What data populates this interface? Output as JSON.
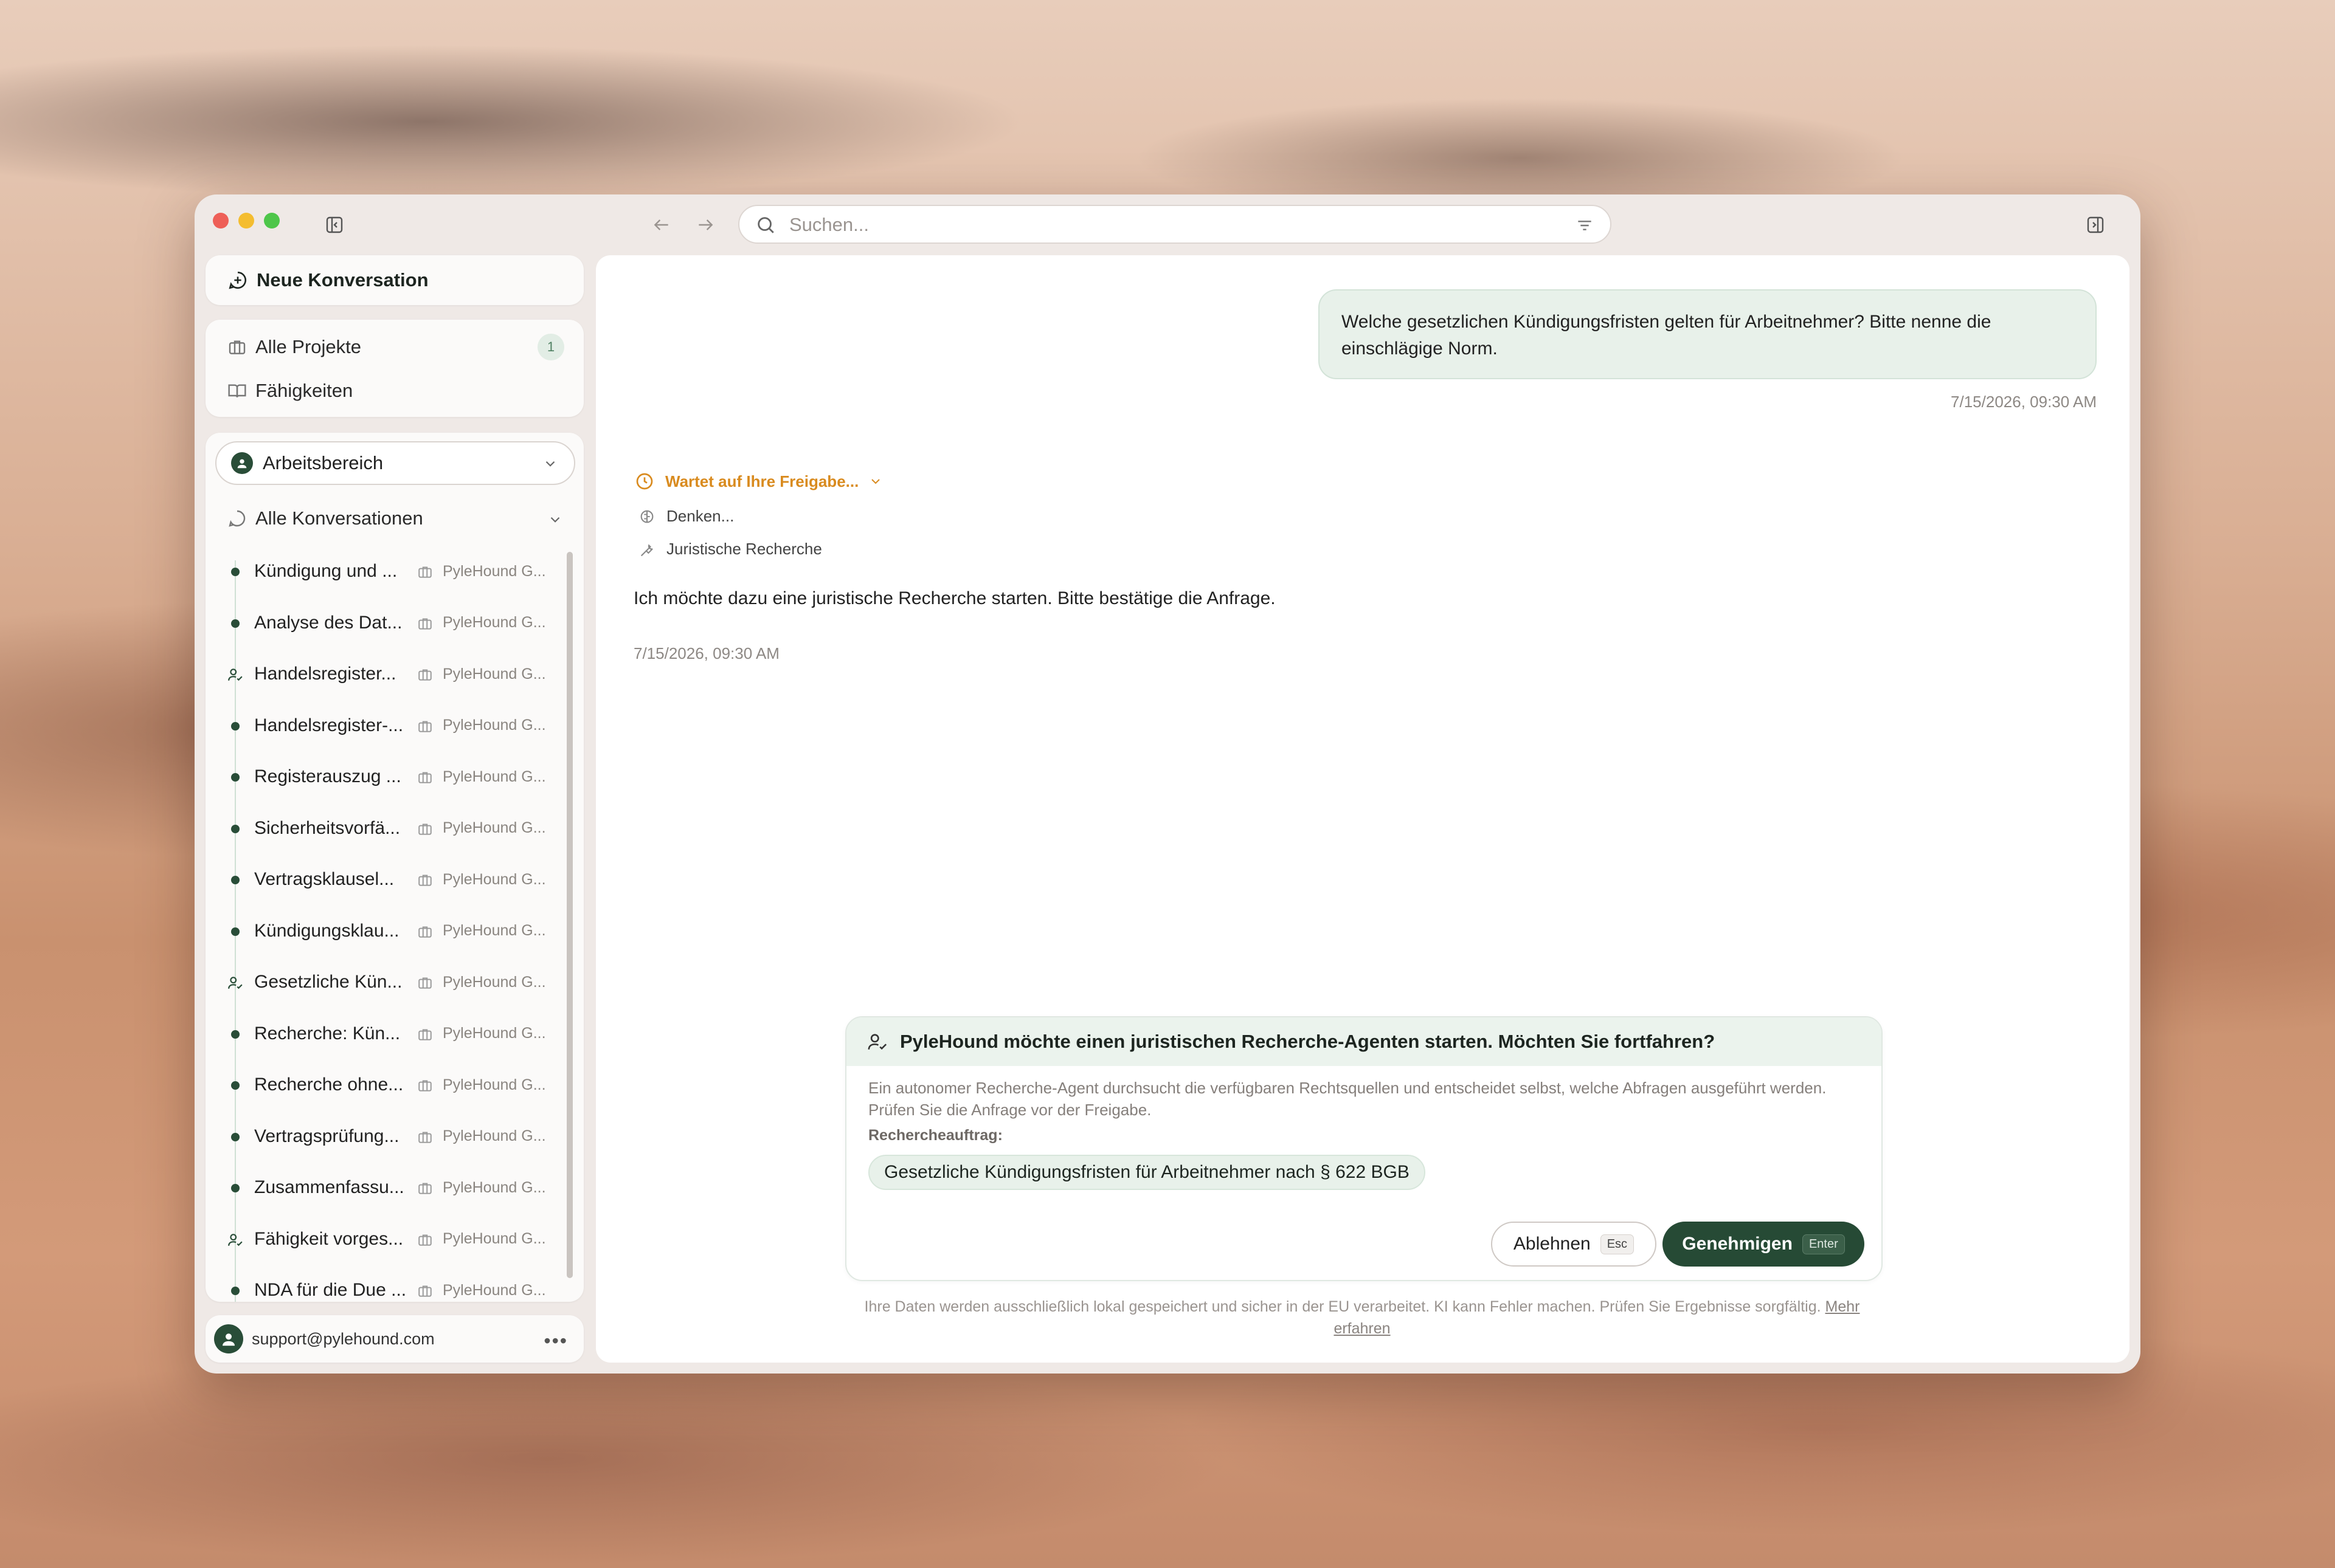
{
  "search": {
    "placeholder": "Suchen..."
  },
  "sidebar": {
    "new_conversation": "Neue Konversation",
    "nav": [
      {
        "label": "Alle Projekte",
        "badge": "1"
      },
      {
        "label": "Fähigkeiten"
      }
    ],
    "workspace": "Arbeitsbereich",
    "all_conversations": "Alle Konversationen",
    "conversations": [
      {
        "title": "Kündigung und ...",
        "project": "PyleHound G...",
        "marker": "dot"
      },
      {
        "title": "Analyse des Dat...",
        "project": "PyleHound G...",
        "marker": "dot"
      },
      {
        "title": "Handelsregister...",
        "project": "PyleHound G...",
        "marker": "user-check"
      },
      {
        "title": "Handelsregister-...",
        "project": "PyleHound G...",
        "marker": "dot"
      },
      {
        "title": "Registerauszug ...",
        "project": "PyleHound G...",
        "marker": "dot"
      },
      {
        "title": "Sicherheitsvorfä...",
        "project": "PyleHound G...",
        "marker": "dot"
      },
      {
        "title": "Vertragsklausel...",
        "project": "PyleHound G...",
        "marker": "dot"
      },
      {
        "title": "Kündigungsklau...",
        "project": "PyleHound G...",
        "marker": "dot"
      },
      {
        "title": "Gesetzliche Kün...",
        "project": "PyleHound G...",
        "marker": "user-check"
      },
      {
        "title": "Recherche: Kün...",
        "project": "PyleHound G...",
        "marker": "dot"
      },
      {
        "title": "Recherche ohne...",
        "project": "PyleHound G...",
        "marker": "dot"
      },
      {
        "title": "Vertragsprüfung...",
        "project": "PyleHound G...",
        "marker": "dot"
      },
      {
        "title": "Zusammenfassu...",
        "project": "PyleHound G...",
        "marker": "dot"
      },
      {
        "title": "Fähigkeit vorges...",
        "project": "PyleHound G...",
        "marker": "user-check"
      },
      {
        "title": "NDA für die Due ...",
        "project": "PyleHound G...",
        "marker": "dot"
      }
    ],
    "user_email": "support@pylehound.com"
  },
  "chat": {
    "user_message": "Welche gesetzlichen Kündigungsfristen gelten für Arbeitnehmer? Bitte nenne die einschlägige Norm.",
    "user_timestamp": "7/15/2026, 09:30 AM",
    "status": "Wartet auf Ihre Freigabe...",
    "steps": [
      "Denken...",
      "Juristische Recherche"
    ],
    "assistant_message": "Ich möchte dazu eine juristische Recherche starten. Bitte bestätige die Anfrage.",
    "assistant_timestamp": "7/15/2026, 09:30 AM"
  },
  "approval": {
    "question": "PyleHound möchte einen juristischen Recherche-Agenten starten. Möchten Sie fortfahren?",
    "description": "Ein autonomer Recherche-Agent durchsucht die verfügbaren Rechtsquellen und entscheidet selbst, welche Abfragen ausgeführt werden. Prüfen Sie die Anfrage vor der Freigabe.",
    "request_label": "Rechercheauftrag:",
    "request": "Gesetzliche Kündigungsfristen für Arbeitnehmer nach § 622 BGB",
    "reject_label": "Ablehnen",
    "reject_key": "Esc",
    "approve_label": "Genehmigen",
    "approve_key": "Enter"
  },
  "footer": {
    "text": "Ihre Daten werden ausschließlich lokal gespeichert und sicher in der EU verarbeitet. KI kann Fehler machen. Prüfen Sie Ergebnisse sorgfältig.",
    "link": "Mehr erfahren"
  },
  "colors": {
    "accent": "#264a35",
    "pending": "#d98b1f",
    "bubble": "#e8f1ea"
  }
}
